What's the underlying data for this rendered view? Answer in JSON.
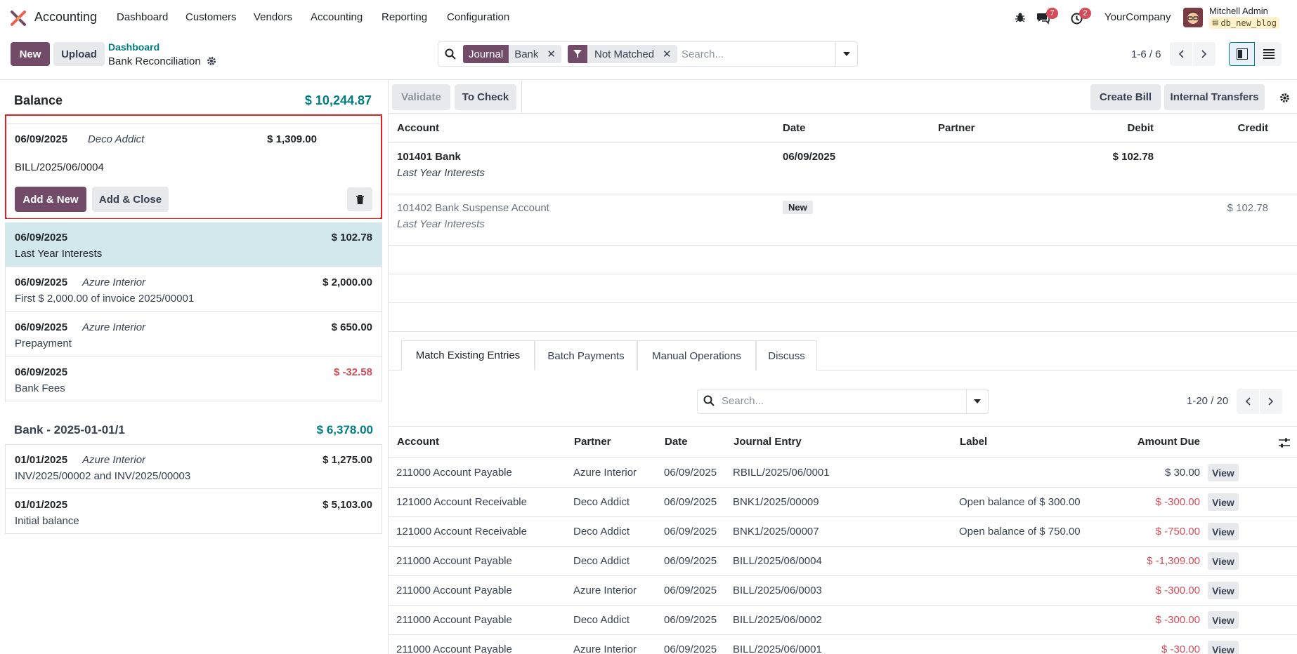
{
  "app": {
    "name": "Accounting"
  },
  "nav": {
    "items": [
      "Dashboard",
      "Customers",
      "Vendors",
      "Accounting",
      "Reporting",
      "Configuration"
    ]
  },
  "systray": {
    "messages_count": "7",
    "activity_count": "2",
    "company": "YourCompany",
    "user_name": "Mitchell Admin",
    "db_name": "db_new_blog"
  },
  "control": {
    "new_label": "New",
    "upload_label": "Upload",
    "breadcrumb_parent": "Dashboard",
    "breadcrumb_current": "Bank Reconciliation",
    "facet_journal_label": "Journal",
    "facet_journal_value": "Bank",
    "facet_filter_value": "Not Matched",
    "search_placeholder": "Search...",
    "pager": "1-6 / 6"
  },
  "left": {
    "balance_label": "Balance",
    "balance_amount": "$ 10,244.87",
    "selected_card": {
      "date": "06/09/2025",
      "partner": "Deco Addict",
      "amount": "$ 1,309.00",
      "ref": "BILL/2025/06/0004",
      "add_new_label": "Add & New",
      "add_close_label": "Add & Close"
    },
    "lines": [
      {
        "date": "06/09/2025",
        "partner": "",
        "amount": "$ 102.78",
        "label": "Last Year Interests"
      },
      {
        "date": "06/09/2025",
        "partner": "Azure Interior",
        "amount": "$ 2,000.00",
        "label": "First $ 2,000.00 of invoice 2025/00001"
      },
      {
        "date": "06/09/2025",
        "partner": "Azure Interior",
        "amount": "$ 650.00",
        "label": "Prepayment"
      },
      {
        "date": "06/09/2025",
        "partner": "",
        "amount": "$ -32.58",
        "label": "Bank Fees"
      }
    ],
    "statement_label": "Bank - 2025-01-01/1",
    "statement_amount": "$ 6,378.00",
    "statement_lines": [
      {
        "date": "01/01/2025",
        "partner": "Azure Interior",
        "amount": "$ 1,275.00",
        "label": "INV/2025/00002 and INV/2025/00003"
      },
      {
        "date": "01/01/2025",
        "partner": "",
        "amount": "$ 5,103.00",
        "label": "Initial balance"
      }
    ]
  },
  "right": {
    "validate_label": "Validate",
    "to_check_label": "To Check",
    "create_bill_label": "Create Bill",
    "internal_transfers_label": "Internal Transfers",
    "headers": {
      "account": "Account",
      "date": "Date",
      "partner": "Partner",
      "debit": "Debit",
      "credit": "Credit"
    },
    "entries": [
      {
        "account": "101401 Bank",
        "label": "Last Year Interests",
        "date": "06/09/2025",
        "partner": "",
        "debit": "$ 102.78",
        "credit": ""
      },
      {
        "account": "101402 Bank Suspense Account",
        "label": "Last Year Interests",
        "badge": "New",
        "partner": "",
        "debit": "",
        "credit": "$ 102.78"
      }
    ],
    "tabs": [
      "Match Existing Entries",
      "Batch Payments",
      "Manual Operations",
      "Discuss"
    ],
    "match_search_placeholder": "Search...",
    "match_pager": "1-20 / 20",
    "match_headers": {
      "account": "Account",
      "partner": "Partner",
      "date": "Date",
      "journal_entry": "Journal Entry",
      "label": "Label",
      "amount_due": "Amount Due"
    },
    "view_label": "View",
    "match_rows": [
      {
        "account": "211000 Account Payable",
        "partner": "Azure Interior",
        "date": "06/09/2025",
        "entry": "RBILL/2025/06/0001",
        "label": "",
        "amount": "$ 30.00",
        "negative": false
      },
      {
        "account": "121000 Account Receivable",
        "partner": "Deco Addict",
        "date": "06/09/2025",
        "entry": "BNK1/2025/00009",
        "label": "Open balance of $ 300.00",
        "amount": "$ -300.00",
        "negative": true
      },
      {
        "account": "121000 Account Receivable",
        "partner": "Deco Addict",
        "date": "06/09/2025",
        "entry": "BNK1/2025/00007",
        "label": "Open balance of $ 750.00",
        "amount": "$ -750.00",
        "negative": true
      },
      {
        "account": "211000 Account Payable",
        "partner": "Deco Addict",
        "date": "06/09/2025",
        "entry": "BILL/2025/06/0004",
        "label": "",
        "amount": "$ -1,309.00",
        "negative": true
      },
      {
        "account": "211000 Account Payable",
        "partner": "Azure Interior",
        "date": "06/09/2025",
        "entry": "BILL/2025/06/0003",
        "label": "",
        "amount": "$ -300.00",
        "negative": true
      },
      {
        "account": "211000 Account Payable",
        "partner": "Deco Addict",
        "date": "06/09/2025",
        "entry": "BILL/2025/06/0002",
        "label": "",
        "amount": "$ -300.00",
        "negative": true
      },
      {
        "account": "211000 Account Payable",
        "partner": "Azure Interior",
        "date": "06/09/2025",
        "entry": "BILL/2025/06/0001",
        "label": "",
        "amount": "$ -30.00",
        "negative": true
      }
    ]
  },
  "colors": {
    "brand": "#714b67",
    "teal": "#017e84",
    "negative": "#d44c59",
    "selected_row": "#d2e8ed",
    "highlight_border": "#e02020"
  }
}
